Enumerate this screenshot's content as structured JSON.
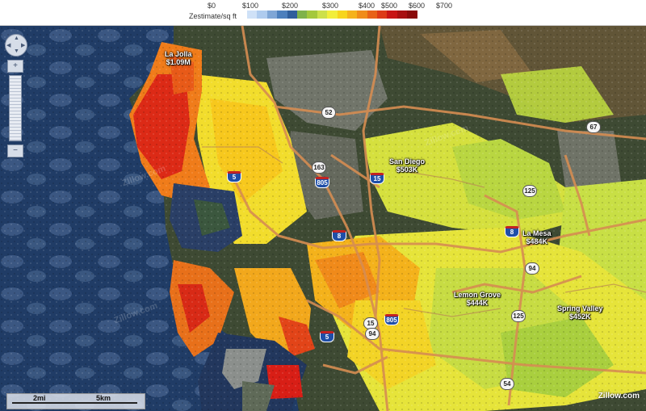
{
  "legend": {
    "label": "Zestimate/sq ft",
    "ticks": [
      "$0",
      "$100",
      "$200",
      "$300",
      "$400",
      "$500",
      "$600",
      "$700"
    ],
    "swatch_colors": [
      "#cfe1f7",
      "#aecbee",
      "#7fa6d6",
      "#4c7fbd",
      "#2f5e9c",
      "#7fb24a",
      "#a4c83c",
      "#cde04a",
      "#f2ee3a",
      "#f7d51c",
      "#f5b21c",
      "#f08c1a",
      "#e86218",
      "#dd3a17",
      "#c81414",
      "#a80f10",
      "#8a0a0a"
    ]
  },
  "places": [
    {
      "name": "La Jolla",
      "value": "$1.09M"
    },
    {
      "name": "San Diego",
      "value": "$503K"
    },
    {
      "name": "La Mesa",
      "value": "$484K"
    },
    {
      "name": "Lemon Grove",
      "value": "$444K"
    },
    {
      "name": "Spring Valley",
      "value": "$452K"
    }
  ],
  "shields": {
    "interstate": [
      "5",
      "805",
      "15",
      "8",
      "8",
      "805",
      "5"
    ],
    "state": [
      "52",
      "163",
      "125",
      "67",
      "94",
      "15",
      "94",
      "125",
      "54"
    ]
  },
  "scale": {
    "miles": "2mi",
    "km": "5km"
  },
  "attribution": "Zillow.com",
  "watermark": "Zillow.com",
  "nav": {
    "zoom_in": "+",
    "zoom_out": "−"
  },
  "colors": {
    "ocean": "#1f3a63",
    "red_high": "#d81e16",
    "orange": "#f0901c",
    "yellow": "#f4e83a",
    "green_low": "#a8d23a",
    "road": "#d68d52"
  }
}
